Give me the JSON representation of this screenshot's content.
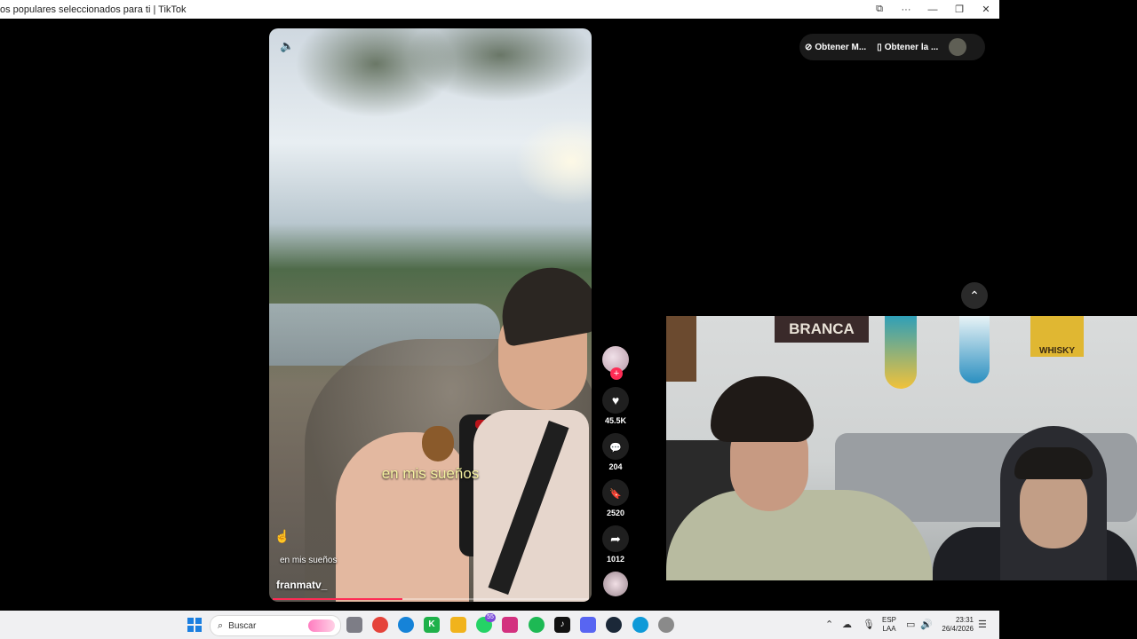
{
  "window": {
    "title": "os populares seleccionados para ti | TikTok",
    "controls": {
      "extension": "⧉",
      "more": "···",
      "minimize": "—",
      "restore": "❐",
      "close": "✕"
    }
  },
  "header": {
    "get_app_label": "Obtener M...",
    "get_desktop_label": "Obtener la ...",
    "coin_icon": "coin-icon",
    "device_icon": "device-icon"
  },
  "video": {
    "subtitle": "en mis sueños",
    "caption": "en mis sueños",
    "author": "franmatv_",
    "progress": 0.41,
    "mute_icon": "🔈"
  },
  "actions": {
    "follow_plus": "+",
    "likes": "45.5K",
    "comments": "204",
    "saves": "2520",
    "shares": "1012",
    "icons": {
      "like": "♥",
      "comment": "💬",
      "save": "🔖",
      "share": "➦"
    }
  },
  "nav": {
    "scroll_up": "⌃"
  },
  "webcam": {
    "sign_text": "BRANCA",
    "whisky_text": "WHISKY"
  },
  "taskbar": {
    "search_placeholder": "Buscar",
    "badge": "55",
    "lang_top": "ESP",
    "lang_bottom": "LAA",
    "time": "23:31",
    "date": "26/4/2026",
    "apps": [
      "task-view",
      "chrome",
      "edge",
      "kick",
      "file-explorer",
      "whatsapp",
      "instagram",
      "spotify",
      "tiktok",
      "discord",
      "steam",
      "edge-browser",
      "settings"
    ],
    "colors": {
      "chrome": "#e5433a",
      "edge": "#1683d8",
      "kick": "#1fb14a",
      "explorer": "#f1b31c",
      "whatsapp": "#25d366",
      "instagram": "#d3317f",
      "spotify": "#1db954",
      "tiktok": "#111111",
      "discord": "#5865f2",
      "steam": "#1b2838"
    }
  }
}
